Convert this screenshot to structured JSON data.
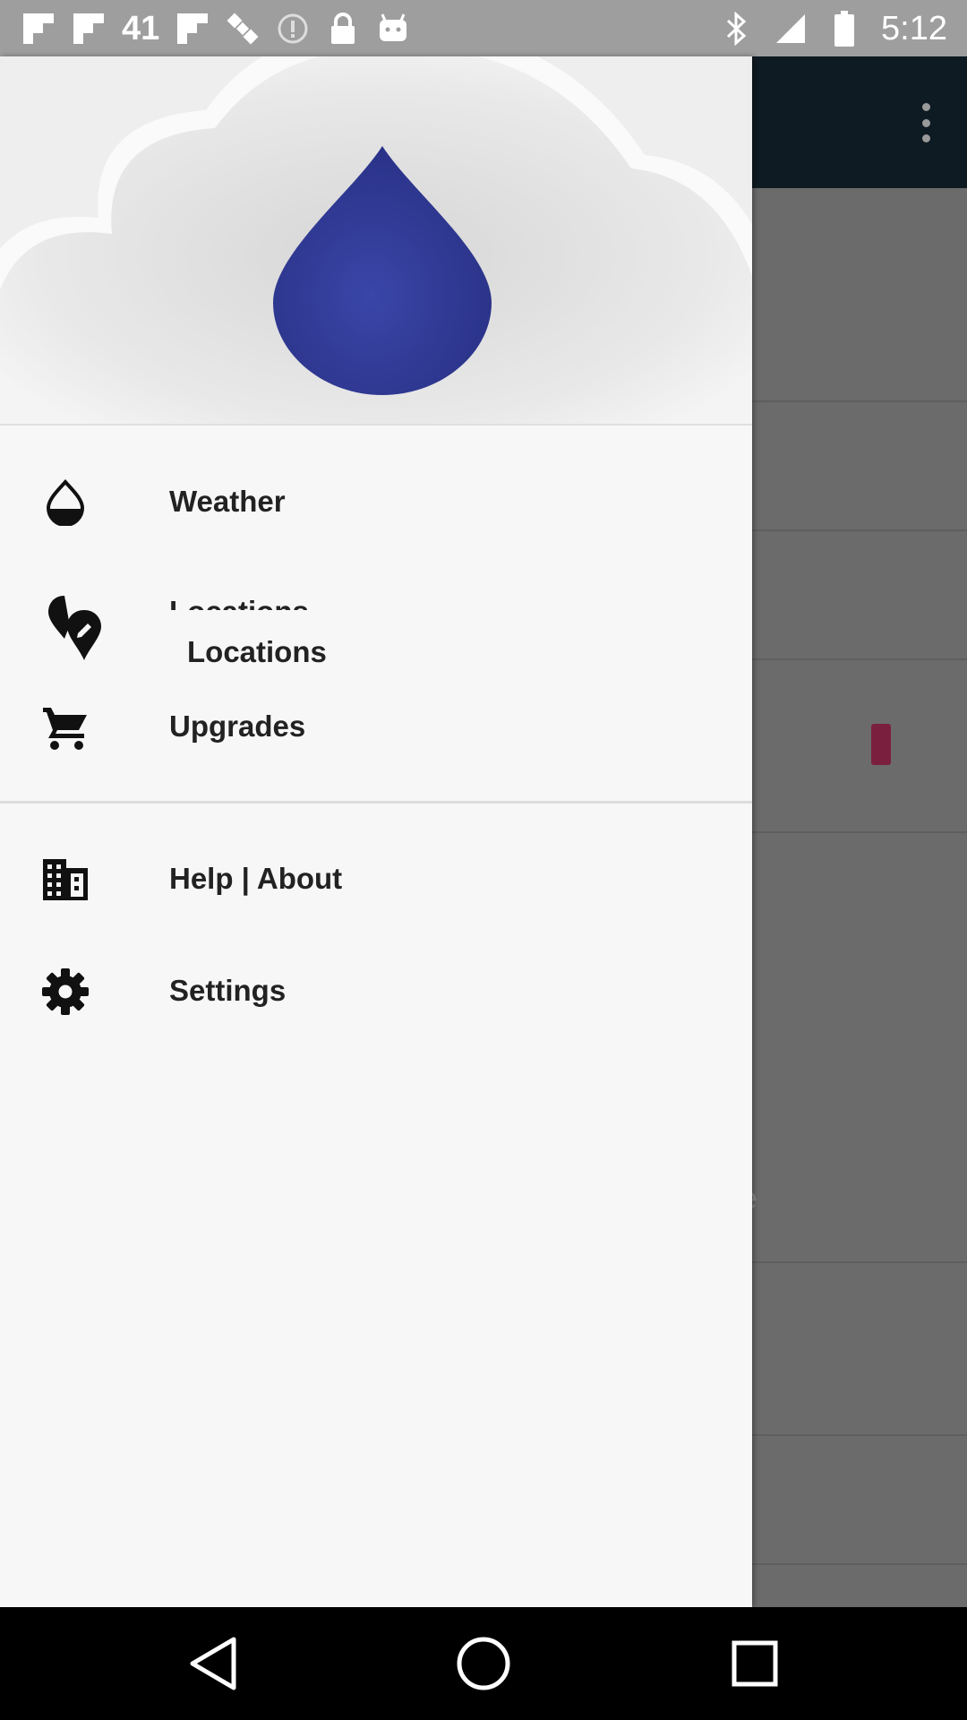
{
  "status_bar": {
    "left_number": "41",
    "time": "5:12",
    "icons": [
      "flipboard-icon",
      "flipboard-icon",
      "flipboard-icon",
      "satellite-icon",
      "info-icon",
      "lock-icon",
      "android-icon",
      "bluetooth-icon",
      "signal-icon",
      "battery-icon"
    ]
  },
  "drawer": {
    "header_image": "raindrop-cloud-logo",
    "items": [
      {
        "label": "Weather",
        "icon": "water-drop-icon"
      },
      {
        "label": "Locations",
        "icon": "edit-location-icon",
        "overlapped_label": "Locations"
      },
      {
        "label": "Upgrades",
        "icon": "cart-icon"
      },
      {
        "label": "Help | About",
        "icon": "building-icon"
      },
      {
        "label": "Settings",
        "icon": "gear-icon"
      }
    ]
  },
  "background_app": {
    "snippet_text": "ze",
    "toolbar_color": "#0f1b22",
    "accent_color": "#7b1f3f"
  },
  "nav_bar": {
    "buttons": [
      "back-icon",
      "home-icon",
      "recents-icon"
    ]
  }
}
